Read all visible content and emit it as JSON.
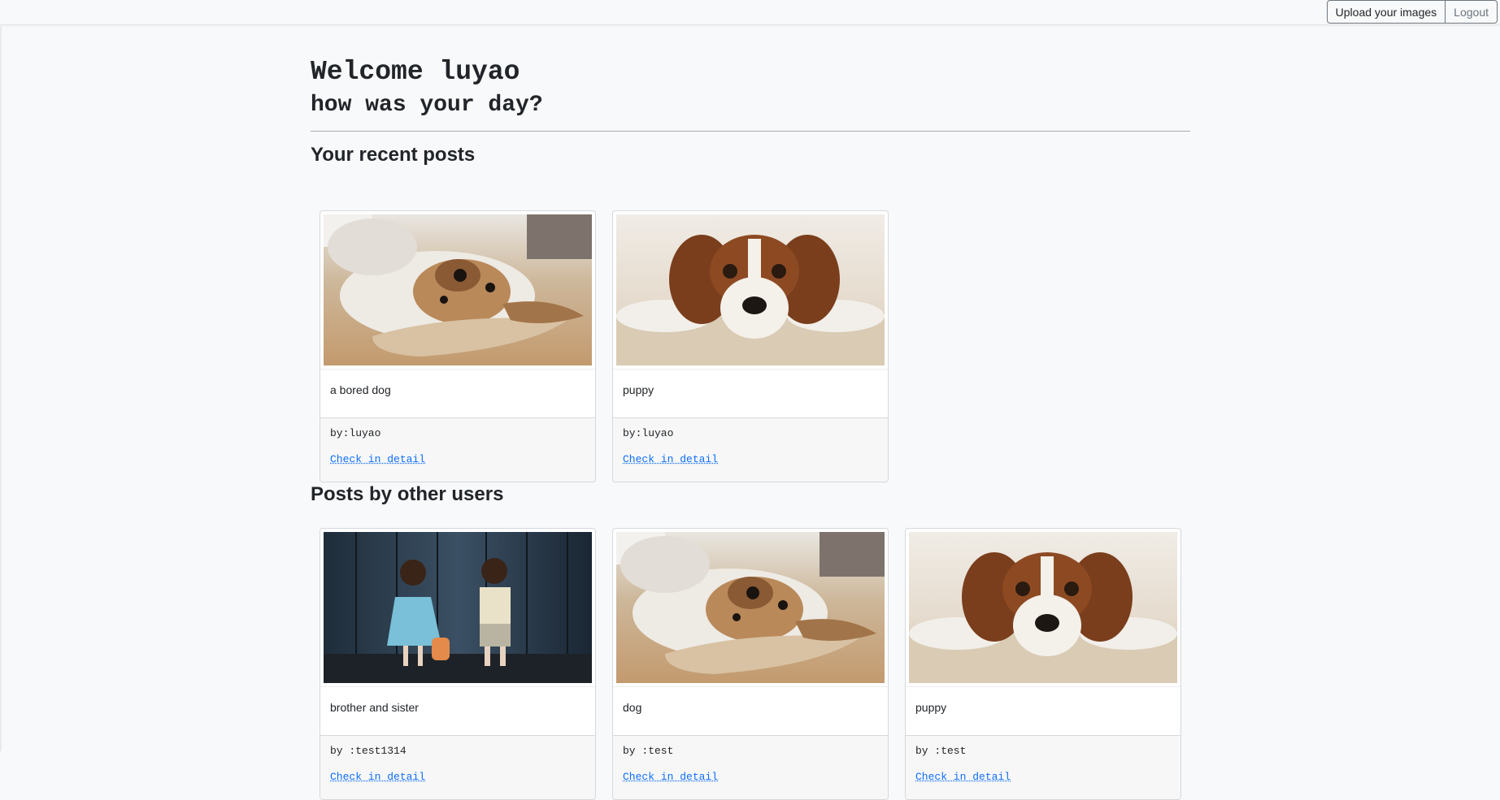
{
  "topbar": {
    "upload_label": "Upload your images",
    "logout_label": "Logout"
  },
  "header": {
    "welcome": "Welcome luyao",
    "subtitle": "how was your day?"
  },
  "recent": {
    "heading": "Your recent posts",
    "posts": [
      {
        "title": "a bored dog",
        "author": "by:luyao",
        "link": "Check in detail"
      },
      {
        "title": "puppy",
        "author": "by:luyao",
        "link": "Check in detail"
      }
    ]
  },
  "others": {
    "heading": "Posts by other users",
    "posts": [
      {
        "title": "brother and sister",
        "author": "by :test1314",
        "link": "Check in detail"
      },
      {
        "title": "dog",
        "author": "by :test",
        "link": "Check in detail"
      },
      {
        "title": "puppy",
        "author": "by :test",
        "link": "Check in detail"
      }
    ]
  }
}
